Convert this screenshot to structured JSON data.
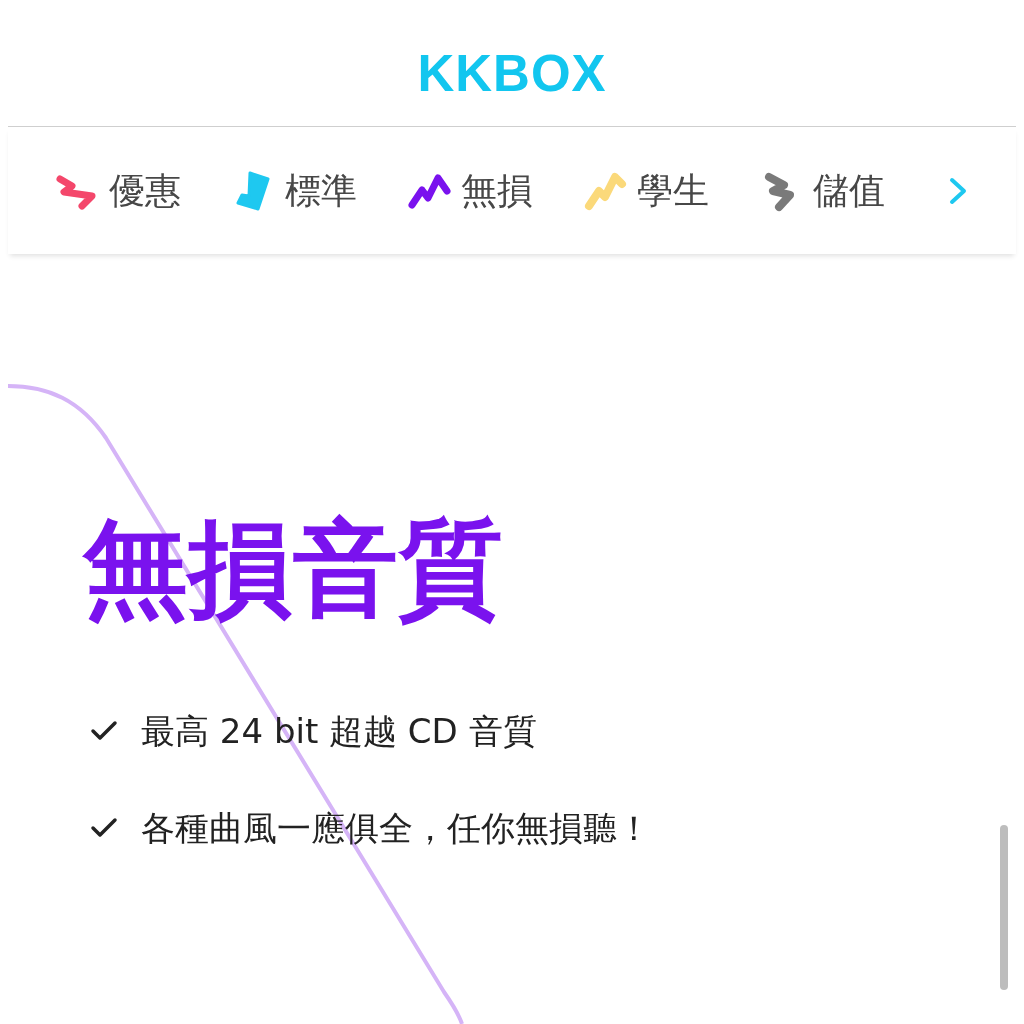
{
  "header": {
    "logo": "KKBOX"
  },
  "plan_nav": {
    "items": [
      {
        "label": "優惠",
        "kind": "zigzag",
        "color": "#f4476b"
      },
      {
        "label": "標準",
        "kind": "tile",
        "color": "#1ec8f0"
      },
      {
        "label": "無損",
        "kind": "wave",
        "color": "#7a12ee"
      },
      {
        "label": "學生",
        "kind": "bolt",
        "color": "#fbd97a"
      },
      {
        "label": "儲值",
        "kind": "stairs",
        "color": "#7a7a7a"
      }
    ]
  },
  "feature": {
    "title": "無損音質",
    "points": [
      "最高 24 bit 超越 CD 音質",
      "各種曲風一應俱全，任你無損聽！"
    ]
  }
}
